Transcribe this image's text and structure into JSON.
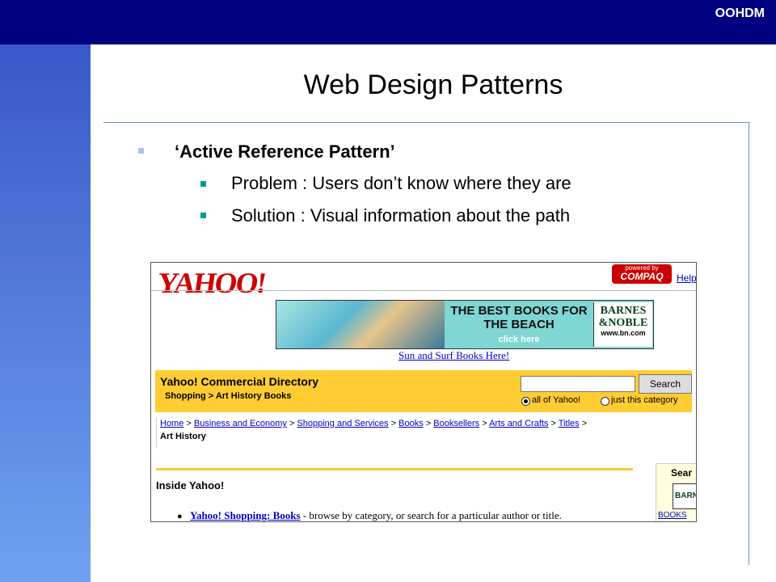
{
  "slide": {
    "brand": "OOHDM",
    "title": "Web Design Patterns",
    "bullets": [
      "‘Active Reference Pattern’",
      "Problem : Users don’t know where they are",
      "Solution : Visual information about the path"
    ]
  },
  "screenshot": {
    "logo": "YAHOO!",
    "sponsor": {
      "line1": "powered by",
      "line2": "COMPAQ"
    },
    "help_link": "Help",
    "banner": {
      "headline": "THE BEST BOOKS FOR THE BEACH",
      "cta": "click here",
      "logo_top": "BARNES &NOBLE",
      "logo_url": "www.bn.com"
    },
    "banner_link": "Sun and Surf Books Here!",
    "directory": {
      "title": "Yahoo! Commercial Directory",
      "subtitle": "Shopping > Art History Books",
      "search_button": "Search",
      "search_value": "",
      "radio_all": "all of Yahoo!",
      "radio_category": "just this category"
    },
    "breadcrumb": {
      "links": [
        "Home",
        "Business and Economy",
        "Shopping and Services",
        "Books",
        "Booksellers",
        "Arts and Crafts",
        "Titles"
      ],
      "separator": ">",
      "current": "Art History"
    },
    "inside_title": "Inside Yahoo!",
    "shopping_item": {
      "link": "Yahoo! Shopping: Books",
      "text": " - browse by category, or search for a particular author or title."
    },
    "sidebar": {
      "heading": "Sear",
      "logo": "BARN",
      "link": "BOOKS"
    }
  },
  "colors": {
    "topbar": "#000080",
    "accent_yellow": "#ffcc33",
    "link_blue": "#0000cc"
  }
}
